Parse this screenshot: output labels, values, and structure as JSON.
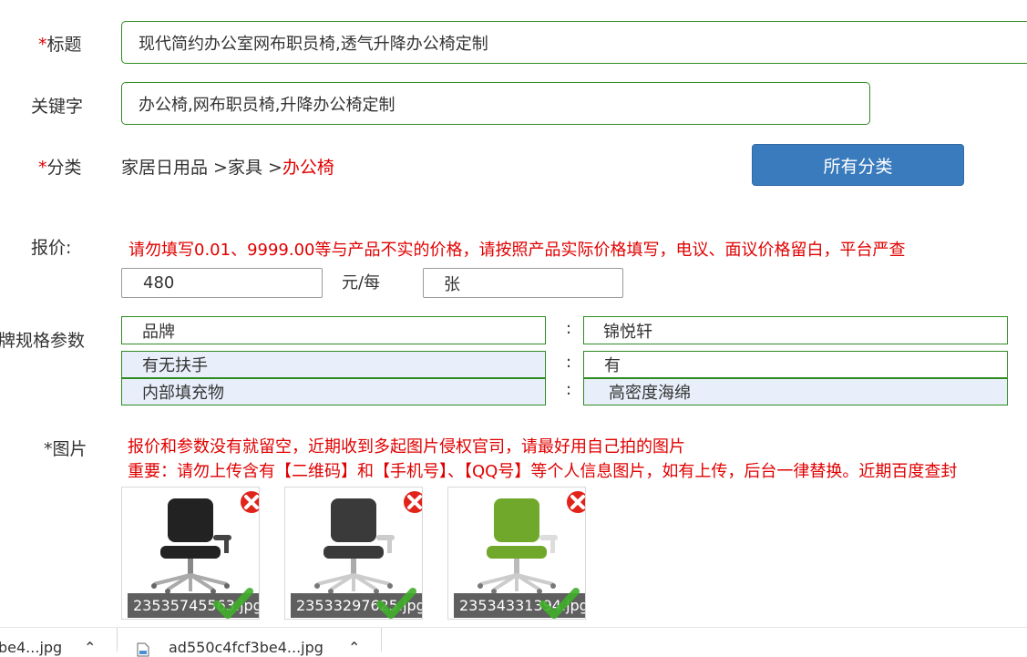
{
  "form": {
    "title": {
      "required_mark": "*",
      "label": "标题",
      "value": "现代简约办公室网布职员椅,透气升降办公椅定制"
    },
    "keywords": {
      "label": "关键字",
      "value": "办公椅,网布职员椅,升降办公椅定制"
    },
    "category": {
      "required_mark": "*",
      "label": "分类",
      "path_prefix": "家居日用品 >家具 >",
      "path_current": "办公椅",
      "button_label": "所有分类"
    },
    "price": {
      "label": "报价:",
      "warning": "请勿填写0.01、9999.00等与产品不实的价格，请按照产品实际价格填写，电议、面议价格留白，平台严查",
      "value": "480",
      "unit_label": "元/每",
      "unit_value": "张"
    },
    "specs": {
      "label": "牌规格参数",
      "separator": ":",
      "rows": [
        {
          "name": "品牌",
          "value": "锦悦轩"
        },
        {
          "name": "有无扶手",
          "value": "有"
        },
        {
          "name": "内部填充物",
          "value": "高密度海绵"
        }
      ]
    },
    "images": {
      "label": "*图片",
      "notice_1": "报价和参数没有就留空，近期收到多起图片侵权官司，请最好用自己拍的图片",
      "notice_2": "重要：请勿上传含有【二维码】和【手机号】、【QQ号】等个人信息图片，如有上传，后台一律替换。近期百度查封",
      "items": [
        {
          "caption": "23535745563.jpg",
          "chair_color": "#222222"
        },
        {
          "caption": "23533297625.jpg",
          "chair_color": "#3a3a3a"
        },
        {
          "caption": "23534331394.jpg",
          "chair_color": "#6fa82a"
        }
      ]
    }
  },
  "downloads": {
    "items": [
      {
        "name": "be4...jpg",
        "icon": "file-icon"
      },
      {
        "name": "ad550c4fcf3be4...jpg",
        "icon": "file-icon"
      }
    ]
  },
  "colors": {
    "accent": "#3a7bbd",
    "required": "#e00000",
    "border_green": "#2e8b22",
    "alt_row": "#e8effa"
  }
}
